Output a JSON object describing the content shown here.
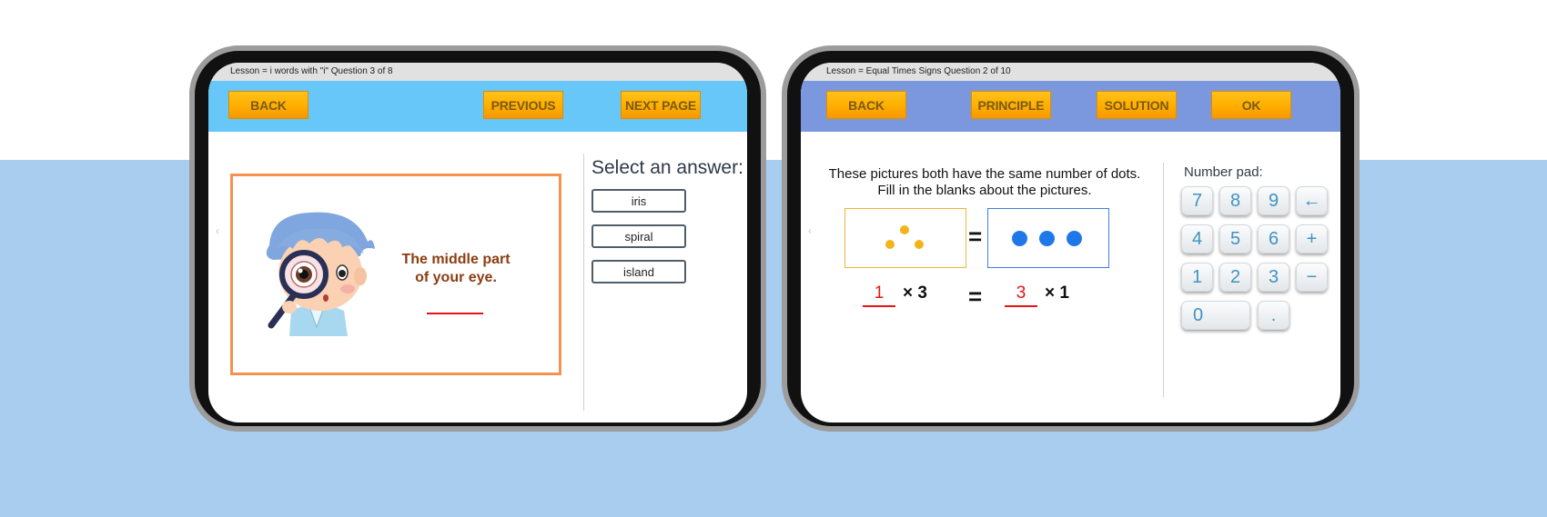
{
  "tablet1": {
    "header": "Lesson = i words with \"i\" Question 3 of 8",
    "buttons": {
      "back": "BACK",
      "previous": "PREVIOUS",
      "next": "NEXT PAGE"
    },
    "prompt_line1": "The middle part",
    "prompt_line2": "of your eye.",
    "select_title": "Select an answer:",
    "answers": [
      "iris",
      "spiral",
      "island"
    ],
    "nav_arrow": "‹"
  },
  "tablet2": {
    "header": "Lesson = Equal Times Signs Question 2 of 10",
    "buttons": {
      "back": "BACK",
      "principle": "PRINCIPLE",
      "solution": "SOLUTION",
      "ok": "OK"
    },
    "instruction_line1": "These pictures both have the same number of dots.",
    "instruction_line2": "Fill in the blanks about the pictures.",
    "equals": "=",
    "left_answer": "1",
    "left_times": "× 3",
    "right_answer": "3",
    "right_times": "× 1",
    "number_pad_title": "Number pad:",
    "keys": [
      "7",
      "8",
      "9",
      "←",
      "4",
      "5",
      "6",
      "+",
      "1",
      "2",
      "3",
      "−",
      "0",
      "."
    ],
    "nav_arrow": "‹",
    "colors": {
      "dot_yellow": "#f3b41b",
      "dot_blue": "#1f78e8"
    }
  }
}
